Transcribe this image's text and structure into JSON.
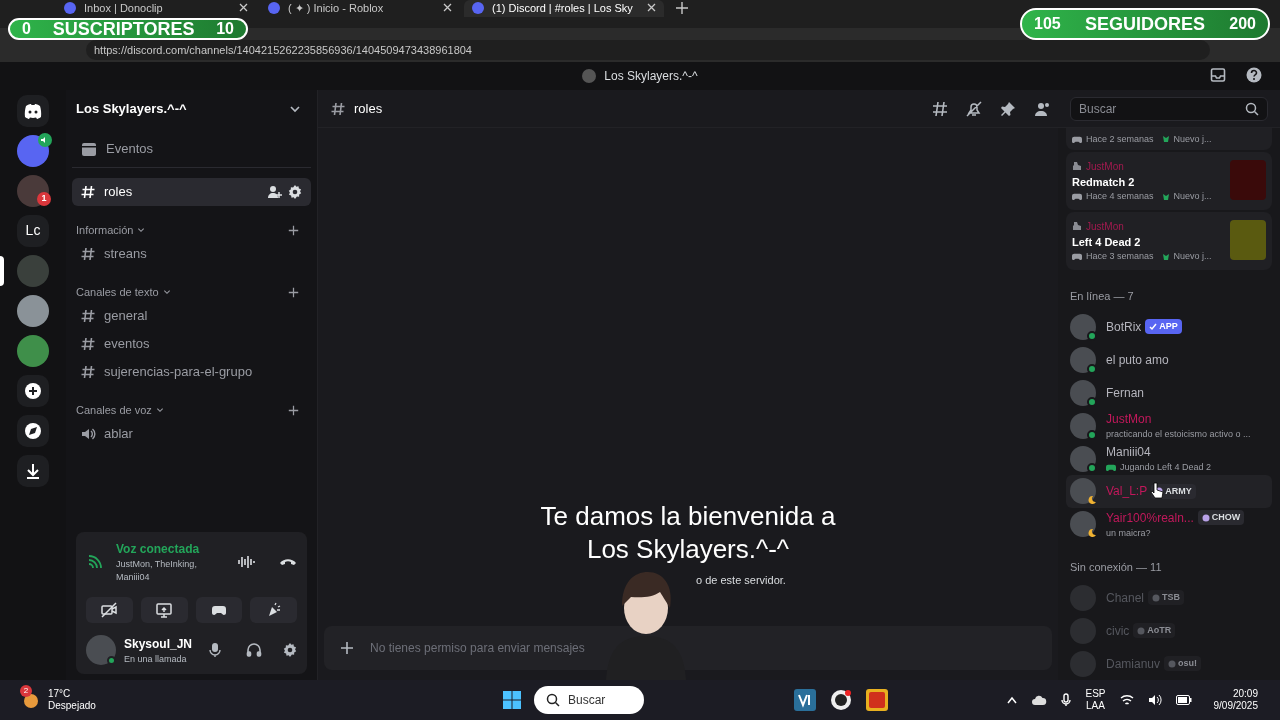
{
  "overlays": {
    "subscribers": {
      "count": "0",
      "label": "SUSCRIPTORES",
      "goal": "10"
    },
    "followers": {
      "count": "105",
      "label": "SEGUIDORES",
      "goal": "200"
    }
  },
  "browser": {
    "tabs": [
      {
        "title": "Inbox | Donoclip",
        "selected": false
      },
      {
        "title": "( ✦ ) Inicio - Roblox",
        "selected": false
      },
      {
        "title": "(1) Discord | #roles | Los Sky",
        "selected": true
      }
    ],
    "url": "https://discord.com/channels/1404215262235856936/1404509473438961804"
  },
  "window": {
    "title": "Los Skylayers.^-^"
  },
  "servers": [
    {
      "kind": "home",
      "selected": false
    },
    {
      "kind": "avatar",
      "selected": false,
      "color": "#5865f2"
    },
    {
      "kind": "avatar",
      "selected": false,
      "badge": "1",
      "color": "#4a3a3a"
    },
    {
      "kind": "text",
      "label": "Lc",
      "selected": false
    },
    {
      "kind": "avatar",
      "selected": true,
      "color": "#3a403c"
    },
    {
      "kind": "avatar",
      "selected": false,
      "color": "#8a9298"
    },
    {
      "kind": "avatar",
      "selected": false,
      "color": "#3f8f4a"
    },
    {
      "kind": "add",
      "selected": false
    },
    {
      "kind": "explore",
      "selected": false
    },
    {
      "kind": "download",
      "selected": false
    }
  ],
  "sidebar": {
    "server_name": "Los Skylayers.^-^",
    "events": "Eventos",
    "channels": [
      {
        "kind": "text",
        "name": "roles",
        "selected": true
      }
    ],
    "categories": [
      {
        "name": "Información",
        "channels": [
          {
            "kind": "text",
            "name": "streans",
            "selected": false
          }
        ]
      },
      {
        "name": "Canales de texto",
        "channels": [
          {
            "kind": "text",
            "name": "general",
            "selected": false
          },
          {
            "kind": "text",
            "name": "eventos",
            "selected": false
          },
          {
            "kind": "text",
            "name": "sujerencias-para-el-grupo",
            "selected": false
          }
        ]
      },
      {
        "name": "Canales de voz",
        "channels": [
          {
            "kind": "voice",
            "name": "ablar",
            "selected": false
          }
        ]
      }
    ]
  },
  "voice_panel": {
    "status": "Voz conectada",
    "members": "JustMon, TheInking, Maniii04"
  },
  "user_panel": {
    "name": "Skysoul_JN",
    "status": "En una llamada"
  },
  "chat": {
    "channel": "roles",
    "welcome_title": "Te damos la bienvenida a Los Skylayers.^-^",
    "welcome_text": "o de este servidor.",
    "composer_placeholder": "No tienes permiso para enviar mensajes"
  },
  "members": {
    "search_placeholder": "Buscar",
    "activities": [
      {
        "time": "Hace 2 semanas",
        "note": "Nuevo j..."
      },
      {
        "user": "JustMon",
        "game": "Redmatch 2",
        "time": "Hace 4 semanas",
        "note": "Nuevo j..."
      },
      {
        "user": "JustMon",
        "game": "Left 4 Dead 2",
        "time": "Hace 3 semanas",
        "note": "Nuevo j..."
      }
    ],
    "groups": [
      {
        "label": "En línea — 7",
        "members": [
          {
            "name": "BotRix",
            "tag": "APP",
            "bot": true,
            "online": true,
            "idle": false,
            "color": "#b5b5bd",
            "selected": false
          },
          {
            "name": "el puto amo",
            "online": true,
            "idle": false,
            "color": "#b5b5bd",
            "selected": false
          },
          {
            "name": "Fernan",
            "online": true,
            "idle": false,
            "color": "#b5b5bd",
            "selected": false
          },
          {
            "name": "JustMon",
            "online": true,
            "idle": false,
            "color": "#c2185b",
            "subtitle": "practicando el estoicismo activo o ...",
            "selected": false
          },
          {
            "name": "Maniii04",
            "online": true,
            "idle": false,
            "color": "#b5b5bd",
            "subtitle": "Jugando Left 4 Dead 2",
            "game": true,
            "selected": false
          },
          {
            "name": "Val_L:P",
            "tag": "ARMY",
            "bot": false,
            "online": true,
            "idle": true,
            "color": "#c2185b",
            "selected": true
          },
          {
            "name": "Yair100%realn...",
            "tag": "CHOW",
            "bot": false,
            "online": true,
            "idle": true,
            "color": "#c2185b",
            "subtitle": "un maicra?",
            "selected": false
          }
        ]
      },
      {
        "label": "Sin conexión — 11",
        "members": [
          {
            "name": "Chanel",
            "tag": "TSB",
            "bot": false,
            "online": false,
            "color": "#55575e",
            "selected": false
          },
          {
            "name": "civic",
            "tag": "AoTR",
            "bot": false,
            "online": false,
            "color": "#55575e",
            "selected": false
          },
          {
            "name": "Damianuv",
            "tag": "osu!",
            "bot": false,
            "online": false,
            "color": "#55575e",
            "selected": false
          }
        ]
      }
    ]
  },
  "taskbar": {
    "weather_badge": "2",
    "temperature": "17°C",
    "condition": "Despejado",
    "search_placeholder": "Buscar",
    "language": "ESP",
    "layout": "LAA",
    "time": "20:09",
    "date": "9/09/2025"
  }
}
